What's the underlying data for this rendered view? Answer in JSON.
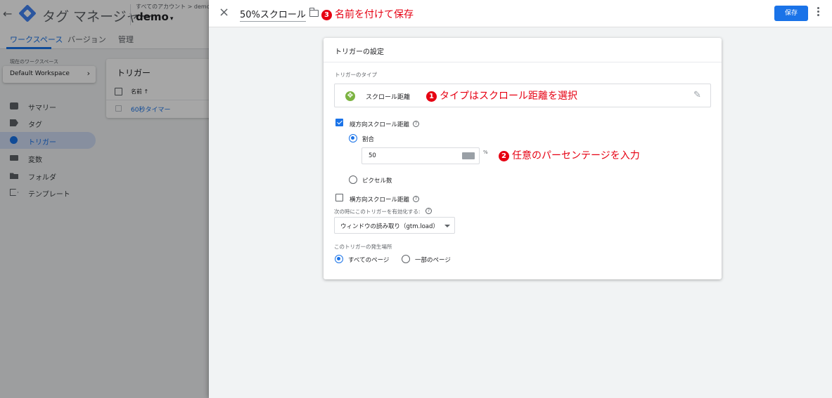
{
  "app": {
    "back_icon": "←",
    "title": "タグ マネージャー",
    "account_crumb": "すべてのアカウント > demo",
    "container_name": "demo",
    "container_caret": "▾",
    "tabs": [
      {
        "label": "ワークスペース"
      },
      {
        "label": "バージョン"
      },
      {
        "label": "管理"
      }
    ],
    "workspace_label": "現在のワークスペース",
    "workspace_name": "Default Workspace",
    "workspace_chevron": "›",
    "nav": [
      {
        "label": "サマリー",
        "icon": "folder-icon"
      },
      {
        "label": "タグ",
        "icon": "tag-icon"
      },
      {
        "label": "トリガー",
        "icon": "trigger-icon"
      },
      {
        "label": "変数",
        "icon": "variable-icon"
      },
      {
        "label": "フォルダ",
        "icon": "folder-icon"
      },
      {
        "label": "テンプレート",
        "icon": "template-icon"
      }
    ],
    "trigger_list": {
      "title": "トリガー",
      "column_name": "名前 ↑",
      "rows": [
        "60秒タイマー"
      ]
    }
  },
  "panel": {
    "close_icon": "×",
    "trigger_name": "50%スクロール",
    "save_label": "保存",
    "annotation_3": {
      "num": "3",
      "text": "名前を付けて保存"
    },
    "card": {
      "title": "トリガーの設定",
      "type_label": "トリガーのタイプ",
      "type_icon": "✥",
      "type_name": "スクロール距離",
      "pencil_icon": "✎",
      "vertical_label": "縦方向スクロール距離",
      "vertical_checked": true,
      "help": "?",
      "percent_label": "割合",
      "percent_value": "50",
      "percent_unit": "%",
      "pixels_label": "ピクセル数",
      "horizontal_label": "横方向スクロール距離",
      "horizontal_checked": false,
      "enable_label": "次の時にこのトリガーを有効化する:",
      "enable_value": "ウィンドウの読み取り（gtm.load）",
      "fire_on_label": "このトリガーの発生場所",
      "fire_all": "すべてのページ",
      "fire_some": "一部のページ"
    },
    "annotation_1": {
      "num": "1",
      "text": "タイプはスクロール距離を選択"
    },
    "annotation_2": {
      "num": "2",
      "text": "任意のパーセンテージを入力"
    }
  },
  "colors": {
    "accent": "#1a73e8",
    "annotation": "#e60012",
    "scroll_icon": "#7cb342"
  }
}
